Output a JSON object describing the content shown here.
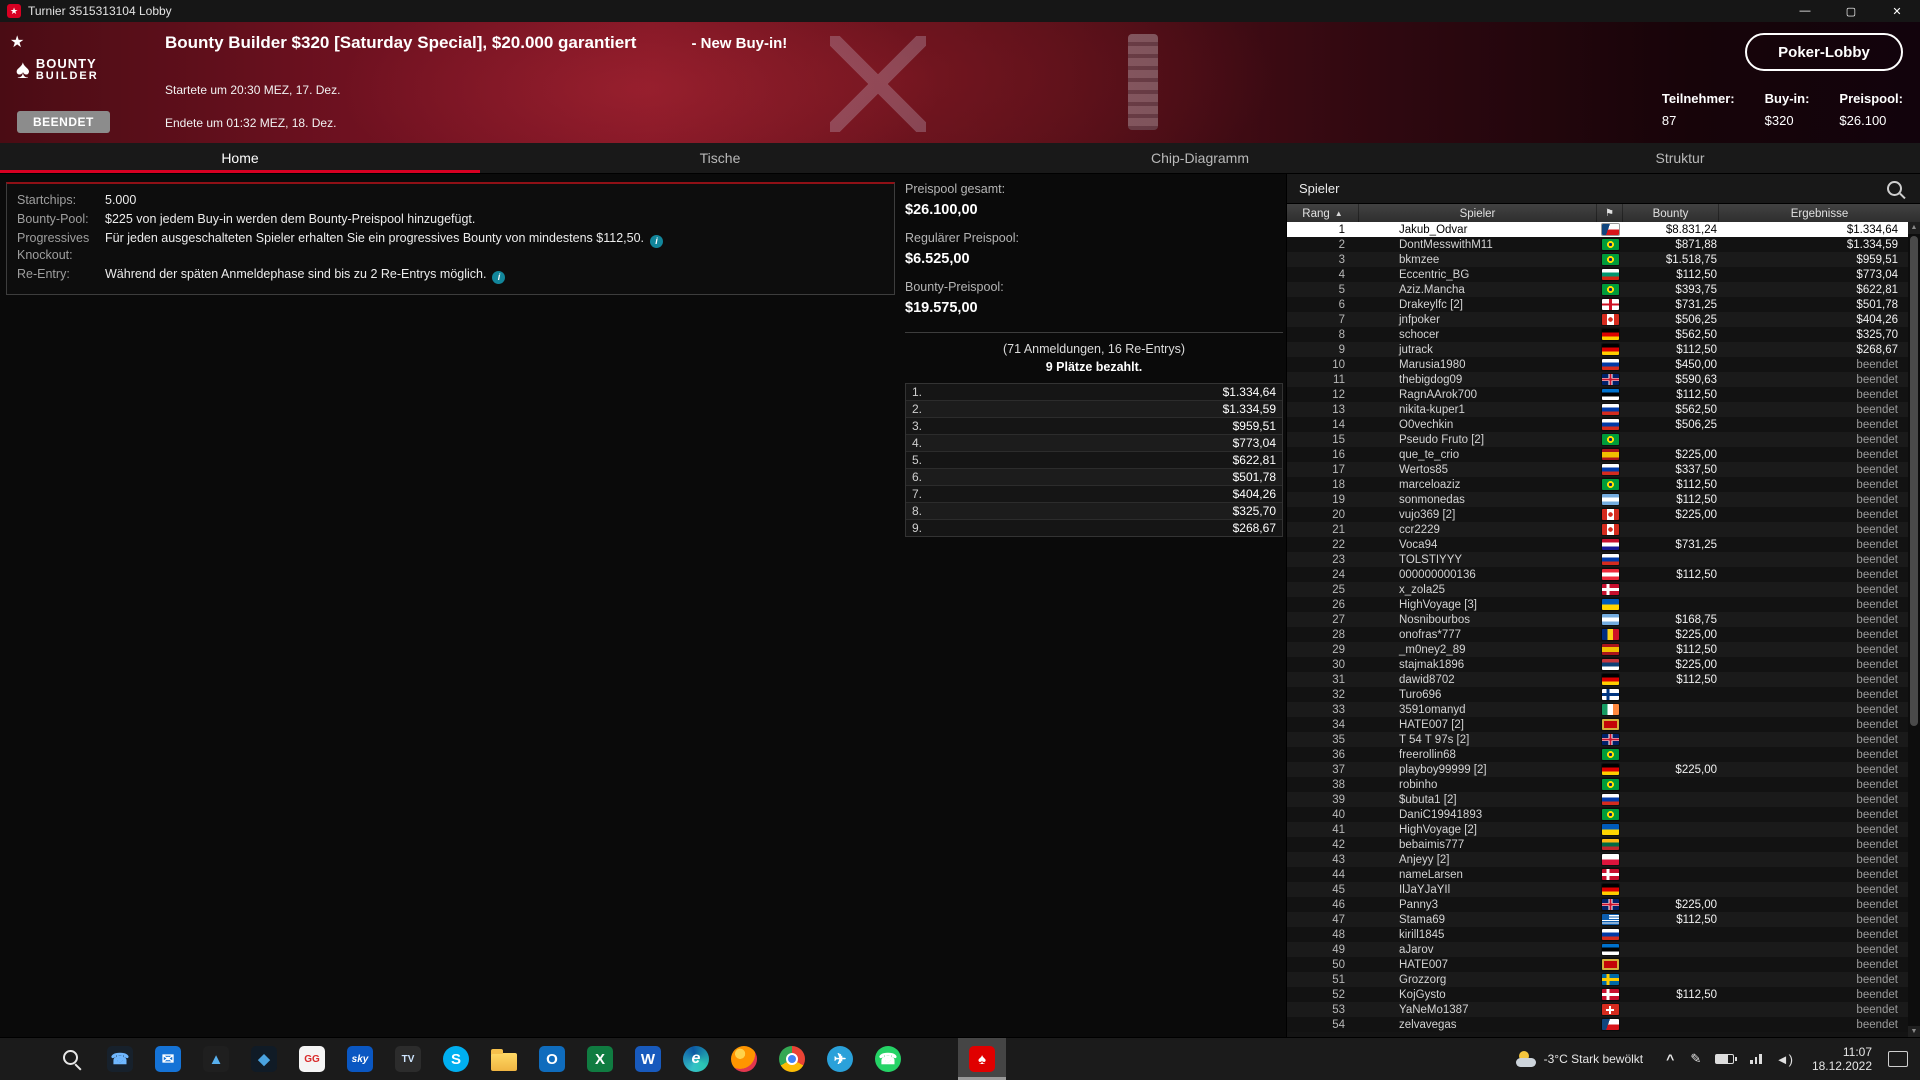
{
  "window": {
    "title": "Turnier 3515313104 Lobby",
    "controls": {
      "minimize": "—",
      "maximize": "▢",
      "close": "✕"
    }
  },
  "header": {
    "logo_line1": "BOUNTY",
    "logo_line2": "BUILDER",
    "title": "Bounty Builder $320 [Saturday Special], $20.000 garantiert",
    "subtitle_extra": "- New Buy-in!",
    "started": "Startete um 20:30 MEZ, 17. Dez.",
    "ended": "Endete um 01:32 MEZ, 18. Dez.",
    "status_badge": "BEENDET",
    "lobby_button": "Poker-Lobby",
    "accent_red": "#d70022",
    "stats": [
      {
        "label": "Teilnehmer:",
        "value": "87"
      },
      {
        "label": "Buy-in:",
        "value": "$320"
      },
      {
        "label": "Preispool:",
        "value": "$26.100"
      }
    ]
  },
  "tabs": [
    {
      "label": "Home",
      "active": true
    },
    {
      "label": "Tische",
      "active": false
    },
    {
      "label": "Chip-Diagramm",
      "active": false
    },
    {
      "label": "Struktur",
      "active": false
    }
  ],
  "info": {
    "rows": [
      {
        "label": "Startchips:",
        "text": "5.000"
      },
      {
        "label": "Bounty-Pool:",
        "text": "$225 von jedem Buy-in werden dem Bounty-Preispool hinzugefügt."
      },
      {
        "label": "Progressives Knockout:",
        "text": "Für jeden ausgeschalteten Spieler erhalten Sie ein progressives Bounty von mindestens $112,50."
      },
      {
        "label": "Re-Entry:",
        "text": "Während der späten Anmeldephase sind bis zu 2 Re-Entrys möglich."
      }
    ]
  },
  "prizepool": {
    "total_label": "Preispool gesamt:",
    "total_value": "$26.100,00",
    "regular_label": "Regulärer Preispool:",
    "regular_value": "$6.525,00",
    "bounty_label": "Bounty-Preispool:",
    "bounty_value": "$19.575,00",
    "entries_line": "(71 Anmeldungen, 16 Re-Entrys)",
    "paid_line": "9 Plätze bezahlt.",
    "payouts": [
      {
        "rank": "1.",
        "amount": "$1.334,64"
      },
      {
        "rank": "2.",
        "amount": "$1.334,59"
      },
      {
        "rank": "3.",
        "amount": "$959,51"
      },
      {
        "rank": "4.",
        "amount": "$773,04"
      },
      {
        "rank": "5.",
        "amount": "$622,81"
      },
      {
        "rank": "6.",
        "amount": "$501,78"
      },
      {
        "rank": "7.",
        "amount": "$404,26"
      },
      {
        "rank": "8.",
        "amount": "$325,70"
      },
      {
        "rank": "9.",
        "amount": "$268,67"
      }
    ]
  },
  "players_panel": {
    "title": "Spieler",
    "columns": {
      "rank": "Rang",
      "player": "Spieler",
      "bounty": "Bounty",
      "result": "Ergebnisse"
    },
    "players": [
      {
        "rank": 1,
        "name": "Jakub_Odvar",
        "flag": "cz",
        "bounty": "$8.831,24",
        "result": "$1.334,64",
        "selected": true
      },
      {
        "rank": 2,
        "name": "DontMesswithM11",
        "flag": "br",
        "bounty": "$871,88",
        "result": "$1.334,59"
      },
      {
        "rank": 3,
        "name": "bkmzee",
        "flag": "br",
        "bounty": "$1.518,75",
        "result": "$959,51"
      },
      {
        "rank": 4,
        "name": "Eccentric_BG",
        "flag": "bg",
        "bounty": "$112,50",
        "result": "$773,04"
      },
      {
        "rank": 5,
        "name": "Aziz.Mancha",
        "flag": "br",
        "bounty": "$393,75",
        "result": "$622,81"
      },
      {
        "rank": 6,
        "name": "Drakeylfc [2]",
        "flag": "eng",
        "bounty": "$731,25",
        "result": "$501,78"
      },
      {
        "rank": 7,
        "name": "jnfpoker",
        "flag": "ca",
        "bounty": "$506,25",
        "result": "$404,26"
      },
      {
        "rank": 8,
        "name": "schocer",
        "flag": "de",
        "bounty": "$562,50",
        "result": "$325,70"
      },
      {
        "rank": 9,
        "name": "jutrack",
        "flag": "de",
        "bounty": "$112,50",
        "result": "$268,67"
      },
      {
        "rank": 10,
        "name": "Marusia1980",
        "flag": "ru",
        "bounty": "$450,00",
        "result": "beendet"
      },
      {
        "rank": 11,
        "name": "thebigdog09",
        "flag": "gb",
        "bounty": "$590,63",
        "result": "beendet"
      },
      {
        "rank": 12,
        "name": "RagnAArok700",
        "flag": "ee",
        "bounty": "$112,50",
        "result": "beendet"
      },
      {
        "rank": 13,
        "name": "nikita-kuper1",
        "flag": "ru",
        "bounty": "$562,50",
        "result": "beendet"
      },
      {
        "rank": 14,
        "name": "O0vechkin",
        "flag": "ru",
        "bounty": "$506,25",
        "result": "beendet"
      },
      {
        "rank": 15,
        "name": "Pseudo Fruto [2]",
        "flag": "br",
        "bounty": "",
        "result": "beendet"
      },
      {
        "rank": 16,
        "name": "que_te_crio",
        "flag": "es",
        "bounty": "$225,00",
        "result": "beendet"
      },
      {
        "rank": 17,
        "name": "Wertos85",
        "flag": "ru",
        "bounty": "$337,50",
        "result": "beendet"
      },
      {
        "rank": 18,
        "name": "marceloaziz",
        "flag": "br",
        "bounty": "$112,50",
        "result": "beendet"
      },
      {
        "rank": 19,
        "name": "sonmonedas",
        "flag": "ar",
        "bounty": "$112,50",
        "result": "beendet"
      },
      {
        "rank": 20,
        "name": "vujo369 [2]",
        "flag": "ca",
        "bounty": "$225,00",
        "result": "beendet"
      },
      {
        "rank": 21,
        "name": "ccr2229",
        "flag": "ca",
        "bounty": "",
        "result": "beendet"
      },
      {
        "rank": 22,
        "name": "Voca94",
        "flag": "hr",
        "bounty": "$731,25",
        "result": "beendet"
      },
      {
        "rank": 23,
        "name": "TOLSTIYYY",
        "flag": "ru",
        "bounty": "",
        "result": "beendet"
      },
      {
        "rank": 24,
        "name": "000000000136",
        "flag": "at",
        "bounty": "$112,50",
        "result": "beendet"
      },
      {
        "rank": 25,
        "name": "x_zola25",
        "flag": "dk",
        "bounty": "",
        "result": "beendet"
      },
      {
        "rank": 26,
        "name": "HighVoyage [3]",
        "flag": "ua",
        "bounty": "",
        "result": "beendet"
      },
      {
        "rank": 27,
        "name": "Nosnibourbos",
        "flag": "ar",
        "bounty": "$168,75",
        "result": "beendet"
      },
      {
        "rank": 28,
        "name": "onofras*777",
        "flag": "ro",
        "bounty": "$225,00",
        "result": "beendet"
      },
      {
        "rank": 29,
        "name": "_m0ney2_89",
        "flag": "es",
        "bounty": "$112,50",
        "result": "beendet"
      },
      {
        "rank": 30,
        "name": "stajmak1896",
        "flag": "rs",
        "bounty": "$225,00",
        "result": "beendet"
      },
      {
        "rank": 31,
        "name": "dawid8702",
        "flag": "de",
        "bounty": "$112,50",
        "result": "beendet"
      },
      {
        "rank": 32,
        "name": "Turo696",
        "flag": "fi",
        "bounty": "",
        "result": "beendet"
      },
      {
        "rank": 33,
        "name": "3591omanyd",
        "flag": "ie",
        "bounty": "",
        "result": "beendet"
      },
      {
        "rank": 34,
        "name": "HATE007 [2]",
        "flag": "me",
        "bounty": "",
        "result": "beendet"
      },
      {
        "rank": 35,
        "name": "T 54 T 97s [2]",
        "flag": "gb",
        "bounty": "",
        "result": "beendet"
      },
      {
        "rank": 36,
        "name": "freerollin68",
        "flag": "br",
        "bounty": "",
        "result": "beendet"
      },
      {
        "rank": 37,
        "name": "playboy99999 [2]",
        "flag": "de",
        "bounty": "$225,00",
        "result": "beendet"
      },
      {
        "rank": 38,
        "name": "robinho",
        "flag": "br",
        "bounty": "",
        "result": "beendet"
      },
      {
        "rank": 39,
        "name": "$ubuta1 [2]",
        "flag": "ru",
        "bounty": "",
        "result": "beendet"
      },
      {
        "rank": 40,
        "name": "DaniC19941893",
        "flag": "br",
        "bounty": "",
        "result": "beendet"
      },
      {
        "rank": 41,
        "name": "HighVoyage [2]",
        "flag": "ua",
        "bounty": "",
        "result": "beendet"
      },
      {
        "rank": 42,
        "name": "bebaimis777",
        "flag": "lt",
        "bounty": "",
        "result": "beendet"
      },
      {
        "rank": 43,
        "name": "Anjeyy [2]",
        "flag": "pl",
        "bounty": "",
        "result": "beendet"
      },
      {
        "rank": 44,
        "name": "nameLarsen",
        "flag": "dk",
        "bounty": "",
        "result": "beendet"
      },
      {
        "rank": 45,
        "name": "IlJaYJaYIl",
        "flag": "de",
        "bounty": "",
        "result": "beendet"
      },
      {
        "rank": 46,
        "name": "Panny3",
        "flag": "gb",
        "bounty": "$225,00",
        "result": "beendet"
      },
      {
        "rank": 47,
        "name": "Stama69",
        "flag": "gr",
        "bounty": "$112,50",
        "result": "beendet"
      },
      {
        "rank": 48,
        "name": "kirill1845",
        "flag": "ru",
        "bounty": "",
        "result": "beendet"
      },
      {
        "rank": 49,
        "name": "aJarov",
        "flag": "ee",
        "bounty": "",
        "result": "beendet"
      },
      {
        "rank": 50,
        "name": "HATE007",
        "flag": "me",
        "bounty": "",
        "result": "beendet"
      },
      {
        "rank": 51,
        "name": "Grozzorg",
        "flag": "se",
        "bounty": "",
        "result": "beendet"
      },
      {
        "rank": 52,
        "name": "KojGysto",
        "flag": "dk",
        "bounty": "$112,50",
        "result": "beendet"
      },
      {
        "rank": 53,
        "name": "YaNeMo1387",
        "flag": "ch",
        "bounty": "",
        "result": "beendet"
      },
      {
        "rank": 54,
        "name": "zelvavegas",
        "flag": "cz",
        "bounty": "",
        "result": "beendet"
      }
    ]
  },
  "taskbar": {
    "icons": [
      {
        "name": "start-button",
        "kind": "start"
      },
      {
        "name": "search-button",
        "kind": "search"
      },
      {
        "name": "your-phone-icon",
        "kind": "glyph",
        "shape": "square",
        "bg": "#17212c",
        "fg": "#6fb7ff",
        "glyph": "☎"
      },
      {
        "name": "mail-icon",
        "kind": "glyph",
        "shape": "square",
        "bg": "#1573d6",
        "fg": "#ffffff",
        "glyph": "✉"
      },
      {
        "name": "photos-icon",
        "kind": "glyph",
        "shape": "square",
        "bg": "#1f1f1f",
        "fg": "#58b0ee",
        "glyph": "▲"
      },
      {
        "name": "diamond-app-icon",
        "kind": "glyph",
        "shape": "square",
        "bg": "#101b26",
        "fg": "#4aa3e0",
        "glyph": "◆"
      },
      {
        "name": "gg-poker-icon",
        "kind": "glyph",
        "shape": "square",
        "bg": "#f5f5f5",
        "fg": "#d92a2a",
        "glyph": "GG",
        "small": true
      },
      {
        "name": "sky-icon",
        "kind": "glyph",
        "shape": "square",
        "bg": "#0a57c2",
        "fg": "#ffffff",
        "glyph": "sky",
        "small": true,
        "italic": true
      },
      {
        "name": "tv-app-icon",
        "kind": "glyph",
        "shape": "square",
        "bg": "#2c2c2c",
        "fg": "#cfe6ff",
        "glyph": "TV",
        "small": true
      },
      {
        "name": "skype-icon",
        "kind": "glyph",
        "shape": "circle",
        "bg": "#00aff0",
        "fg": "#ffffff",
        "glyph": "S"
      },
      {
        "name": "file-explorer-icon",
        "kind": "folder"
      },
      {
        "name": "outlook-icon",
        "kind": "glyph",
        "shape": "square",
        "bg": "#0f6cbd",
        "fg": "#ffffff",
        "glyph": "O"
      },
      {
        "name": "excel-icon",
        "kind": "glyph",
        "shape": "square",
        "bg": "#107c41",
        "fg": "#ffffff",
        "glyph": "X"
      },
      {
        "name": "word-icon",
        "kind": "glyph",
        "shape": "square",
        "bg": "#185abd",
        "fg": "#ffffff",
        "glyph": "W"
      },
      {
        "name": "edge-icon",
        "kind": "edge"
      },
      {
        "name": "firefox-icon",
        "kind": "firefox"
      },
      {
        "name": "chrome-icon",
        "kind": "chrome"
      },
      {
        "name": "telegram-icon",
        "kind": "glyph",
        "shape": "circle",
        "bg": "#2aa1da",
        "fg": "#ffffff",
        "glyph": "✈"
      },
      {
        "name": "whatsapp-icon",
        "kind": "glyph",
        "shape": "circle",
        "bg": "#25d366",
        "fg": "#ffffff",
        "glyph": "☎"
      },
      {
        "name": "pokerstars-icon",
        "kind": "glyph",
        "shape": "square",
        "bg": "#e00000",
        "fg": "#ffffff",
        "glyph": "♠",
        "active": true,
        "gap_before": true
      }
    ],
    "tray": {
      "weather": "-3°C Stark bewölkt",
      "time": "11:07",
      "date": "18.12.2022"
    }
  }
}
